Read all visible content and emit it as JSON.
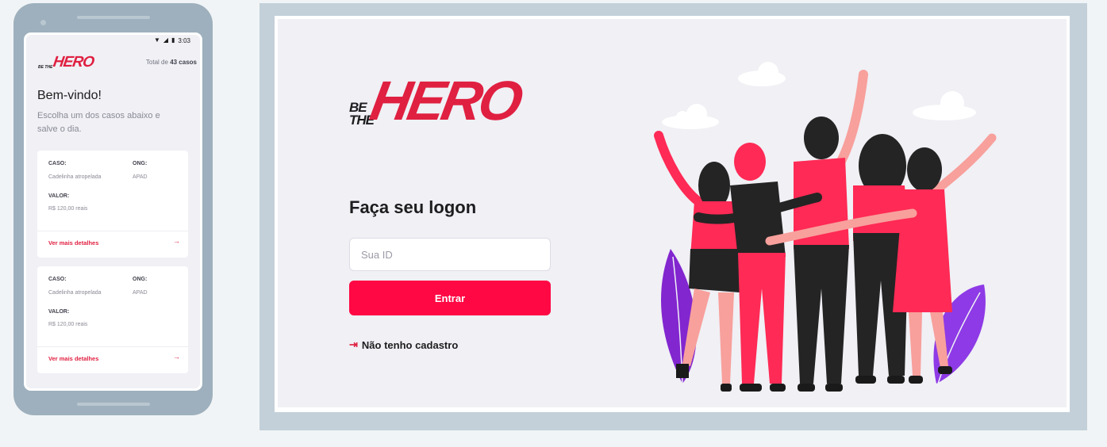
{
  "colors": {
    "brand_red": "#e02041",
    "button_red": "#ff0844",
    "background": "#f0f0f5",
    "frame_blue": "#c3d0d9",
    "phone_body": "#9eb0bd"
  },
  "mobile": {
    "status_bar": {
      "time": "3:03"
    },
    "logo": {
      "be_the": "BE THE",
      "hero": "HERO"
    },
    "total": {
      "prefix": "Total de",
      "count": "43 casos"
    },
    "welcome_title": "Bem-vindo!",
    "subtitle": "Escolha um dos casos abaixo e salve o dia.",
    "cases": [
      {
        "case_label": "CASO:",
        "case_value": "Cadelinha atropelada",
        "ong_label": "ONG:",
        "ong_value": "APAD",
        "value_label": "VALOR:",
        "value_value": "R$ 120,00 reais",
        "details_link": "Ver mais detalhes",
        "arrow_icon": "arrow-right-icon"
      },
      {
        "case_label": "CASO:",
        "case_value": "Cadelinha atropelada",
        "ong_label": "ONG:",
        "ong_value": "APAD",
        "value_label": "VALOR:",
        "value_value": "R$ 120,00 reais",
        "details_link": "Ver mais detalhes",
        "arrow_icon": "arrow-right-icon"
      }
    ]
  },
  "desktop": {
    "logo": {
      "be_the": "BE THE",
      "hero": "HERO"
    },
    "title": "Faça seu logon",
    "id_input": {
      "placeholder": "Sua ID",
      "value": ""
    },
    "submit_button": "Entrar",
    "register_link": {
      "icon": "log-in-icon",
      "label": "Não tenho cadastro"
    },
    "illustration": "group-of-friends-illustration"
  }
}
